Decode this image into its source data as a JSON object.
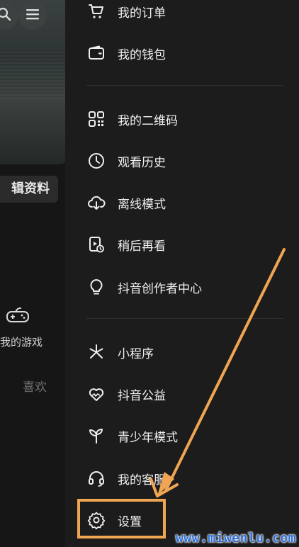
{
  "background_page": {
    "edit_profile_label": "辑资料",
    "games_label": "我的游戏",
    "likes_label": "喜欢"
  },
  "drawer": {
    "items": [
      {
        "label": "我的订单",
        "icon": "cart-icon"
      },
      {
        "label": "我的钱包",
        "icon": "wallet-icon"
      },
      {
        "label": "我的二维码",
        "icon": "qrcode-icon"
      },
      {
        "label": "观看历史",
        "icon": "clock-icon"
      },
      {
        "label": "离线模式",
        "icon": "cloud-download-icon"
      },
      {
        "label": "稍后再看",
        "icon": "watch-later-icon"
      },
      {
        "label": "抖音创作者中心",
        "icon": "lightbulb-icon"
      },
      {
        "label": "小程序",
        "icon": "mini-program-icon"
      },
      {
        "label": "抖音公益",
        "icon": "heart-charity-icon"
      },
      {
        "label": "青少年模式",
        "icon": "sprout-icon"
      },
      {
        "label": "我的客服",
        "icon": "headset-icon"
      },
      {
        "label": "设置",
        "icon": "gear-icon"
      }
    ]
  },
  "annotation": {
    "highlight_color": "#f0a552",
    "highlighted_item": "设置"
  },
  "watermark": "www.miwenlu.com"
}
